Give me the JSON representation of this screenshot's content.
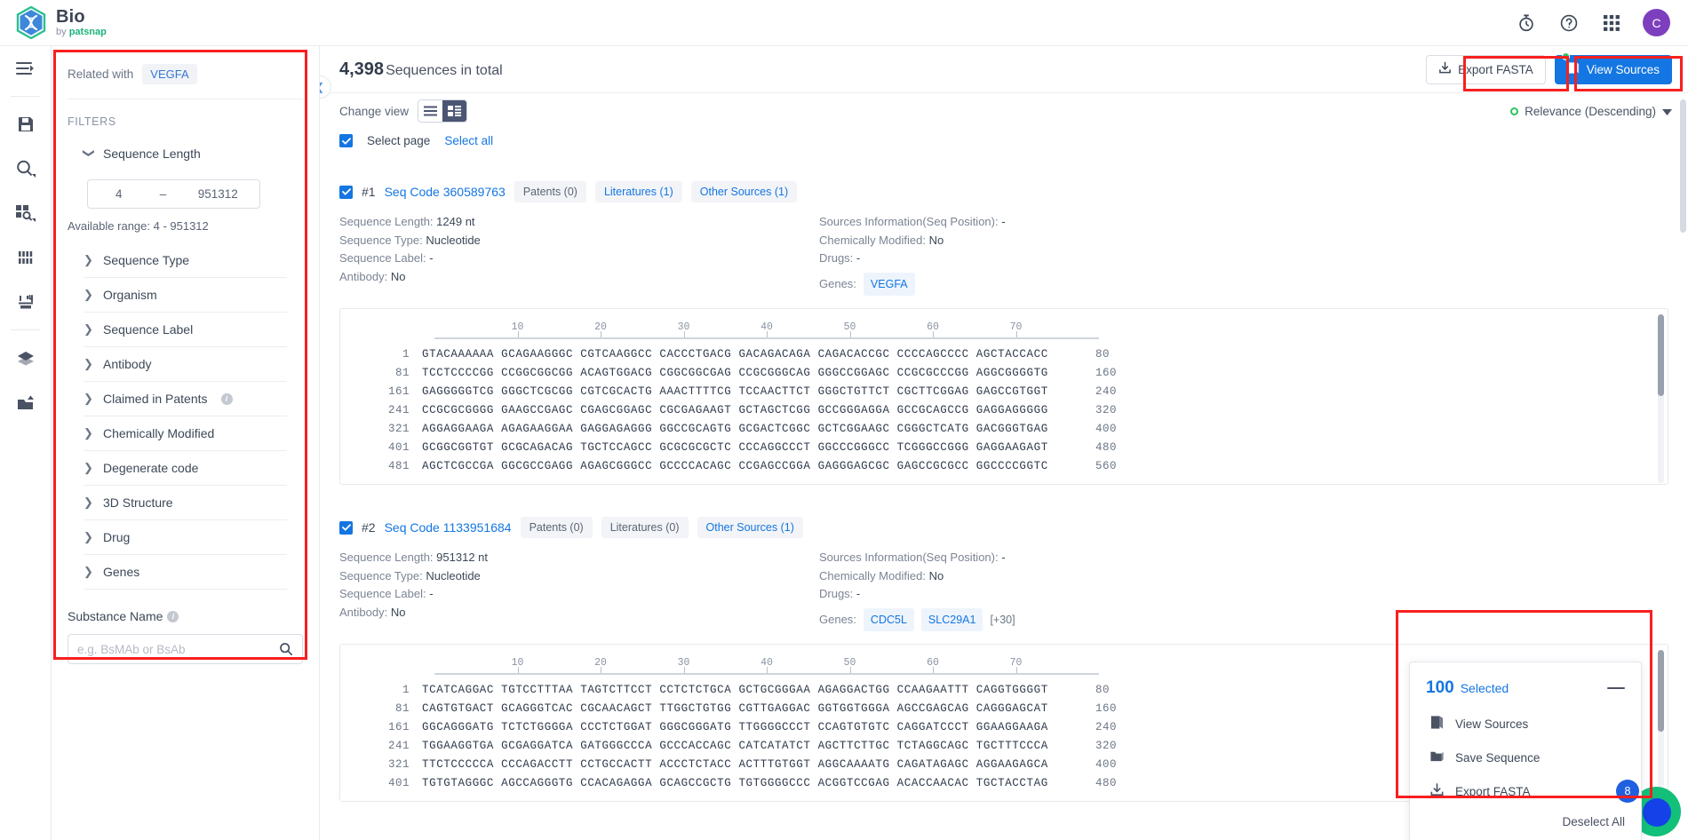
{
  "brand": {
    "title": "Bio",
    "by": "by ",
    "company": "patsnap",
    "logo_icon": "hexagon-dna-icon"
  },
  "topbar": {
    "icons": [
      {
        "name": "history-timer-icon",
        "glyph": "timer"
      },
      {
        "name": "help-question-icon",
        "glyph": "question"
      },
      {
        "name": "apps-grid-icon",
        "glyph": "grid"
      }
    ],
    "avatar_initial": "C",
    "avatar_color": "#7d3fbe"
  },
  "rail": {
    "items": [
      {
        "name": "collapse-menu-icon",
        "glyph": "menu-arrow"
      },
      {
        "name": "saved-documents-icon",
        "glyph": "floppy"
      },
      {
        "name": "search-icon",
        "glyph": "magnifier"
      },
      {
        "name": "structure-search-icon",
        "glyph": "blocks-search"
      },
      {
        "name": "sequence-icon",
        "glyph": "barcode"
      },
      {
        "name": "tools-icon",
        "glyph": "sliders"
      },
      {
        "name": "library-icon",
        "glyph": "box"
      },
      {
        "name": "export-inbox-icon",
        "glyph": "inbox-up"
      }
    ]
  },
  "filters": {
    "related_label": "Related with",
    "related_chip": "VEGFA",
    "heading": "FILTERS",
    "sequence_length": {
      "label": "Sequence Length",
      "min": "4",
      "max": "951312",
      "separator": "–",
      "available_range": "Available range: 4 - 951312"
    },
    "groups": [
      {
        "label": "Sequence Type",
        "info": false
      },
      {
        "label": "Organism",
        "info": false
      },
      {
        "label": "Sequence Label",
        "info": false
      },
      {
        "label": "Antibody",
        "info": false
      },
      {
        "label": "Claimed in Patents",
        "info": true
      },
      {
        "label": "Chemically Modified",
        "info": false
      },
      {
        "label": "Degenerate code",
        "info": false
      },
      {
        "label": "3D Structure",
        "info": false
      },
      {
        "label": "Drug",
        "info": false
      },
      {
        "label": "Genes",
        "info": false
      }
    ],
    "substance": {
      "label": "Substance Name",
      "placeholder": "e.g. BsMAb or BsAb",
      "value": ""
    },
    "highlight_color": "#f81f1f"
  },
  "main": {
    "total_count": "4,398",
    "total_suffix": "Sequences in total",
    "export_fasta": "Export FASTA",
    "view_sources": "View Sources",
    "change_view_label": "Change view",
    "sort_label": "Relevance (Descending)",
    "select_page": "Select page",
    "select_all": "Select all"
  },
  "records": [
    {
      "index": "#1",
      "code_label": "Seq Code 360589763",
      "tags": [
        {
          "text": "Patents (0)",
          "blue": false
        },
        {
          "text": "Literatures (1)",
          "blue": true
        },
        {
          "text": "Other Sources (1)",
          "blue": true
        }
      ],
      "left_fields": [
        {
          "label": "Sequence Length:",
          "value": "1249 nt"
        },
        {
          "label": "Sequence Type:",
          "value": "Nucleotide"
        },
        {
          "label": "Sequence Label:",
          "value": "-"
        },
        {
          "label": "Antibody:",
          "value": "No"
        }
      ],
      "right_fields": [
        {
          "label": "Sources Information(Seq Position):",
          "value": "-"
        },
        {
          "label": "Chemically Modified:",
          "value": "No"
        },
        {
          "label": "Drugs:",
          "value": "-"
        }
      ],
      "genes_label": "Genes:",
      "genes": [
        "VEGFA"
      ],
      "genes_more": "",
      "ruler_ticks": [
        10,
        20,
        30,
        40,
        50,
        60,
        70
      ],
      "rows": [
        {
          "start": "1",
          "bases": "GTACAAAAAA GCAGAAGGGC CGTCAAGGCC CACCCTGACG GACAGACAGA CAGACACCGC CCCCAGCCCC AGCTACCACC",
          "end": "80"
        },
        {
          "start": "81",
          "bases": "TCCTCCCCGG CCGGCGGCGG ACAGTGGACG CGGCGGCGAG CCGCGGGCAG GGGCCGGAGC CCGCGCCCGG AGGCGGGGTG",
          "end": "160"
        },
        {
          "start": "161",
          "bases": "GAGGGGGTCG GGGCTCGCGG CGTCGCACTG AAACTTTTCG TCCAACTTCT GGGCTGTTCT CGCTTCGGAG GAGCCGTGGT",
          "end": "240"
        },
        {
          "start": "241",
          "bases": "CCGCGCGGGG GAAGCCGAGC CGAGCGGAGC CGCGAGAAGT GCTAGCTCGG GCCGGGAGGA GCCGCAGCCG GAGGAGGGGG",
          "end": "320"
        },
        {
          "start": "321",
          "bases": "AGGAGGAAGA AGAGAAGGAA GAGGAGAGGG GGCCGCAGTG GCGACTCGGC GCTCGGAAGC CGGGCTCATG GACGGGTGAG",
          "end": "400"
        },
        {
          "start": "401",
          "bases": "GCGGCGGTGT GCGCAGACAG TGCTCCAGCC GCGCGCGCTC CCCAGGCCCT GGCCCGGGCC TCGGGCCGGG GAGGAAGAGT",
          "end": "480"
        },
        {
          "start": "481",
          "bases": "AGCTCGCCGA GGCGCCGAGG AGAGCGGGCC GCCCCACAGC CCGAGCCGGA GAGGGAGCGC GAGCCGCGCC GGCCCCGGTC",
          "end": "560"
        }
      ]
    },
    {
      "index": "#2",
      "code_label": "Seq Code 1133951684",
      "tags": [
        {
          "text": "Patents (0)",
          "blue": false
        },
        {
          "text": "Literatures (0)",
          "blue": false
        },
        {
          "text": "Other Sources (1)",
          "blue": true
        }
      ],
      "left_fields": [
        {
          "label": "Sequence Length:",
          "value": "951312 nt"
        },
        {
          "label": "Sequence Type:",
          "value": "Nucleotide"
        },
        {
          "label": "Sequence Label:",
          "value": "-"
        },
        {
          "label": "Antibody:",
          "value": "No"
        }
      ],
      "right_fields": [
        {
          "label": "Sources Information(Seq Position):",
          "value": "-"
        },
        {
          "label": "Chemically Modified:",
          "value": "No"
        },
        {
          "label": "Drugs:",
          "value": "-"
        }
      ],
      "genes_label": "Genes:",
      "genes": [
        "CDC5L",
        "SLC29A1"
      ],
      "genes_more": "[+30]",
      "ruler_ticks": [
        10,
        20,
        30,
        40,
        50,
        60,
        70
      ],
      "rows": [
        {
          "start": "1",
          "bases": "TCATCAGGAC TGTCCTTTAA TAGTCTTCCT CCTCTCTGCA GCTGCGGGAA AGAGGACTGG CCAAGAATTT CAGGTGGGGT",
          "end": "80"
        },
        {
          "start": "81",
          "bases": "CAGTGTGACT GCAGGGTCAC CGCAACAGCT TTGGCTGTGG CGTTGAGGAC GGTGGTGGGA AGCCGAGCAG CAGGGAGCAT",
          "end": "160"
        },
        {
          "start": "161",
          "bases": "GGCAGGGATG TCTCTGGGGA CCCTCTGGAT GGGCGGGATG TTGGGGCCCT CCAGTGTGTC CAGGATCCCT GGAAGGAAGA",
          "end": "240"
        },
        {
          "start": "241",
          "bases": "TGGAAGGTGA GCGAGGATCA GATGGGCCCA GCCCACCAGC CATCATATCT AGCTTCTTGC TCTAGGCAGC TGCTTTCCCA",
          "end": "320"
        },
        {
          "start": "321",
          "bases": "TTCTCCCCCA CCCAGACCTT CCTGCCACTT ACCCTCTACC ACTTTGTGGT AGGCAAAATG CAGATAGAGC AGGAAGAGCA",
          "end": "400"
        },
        {
          "start": "401",
          "bases": "TGTGTAGGGC AGCCAGGGTG CCACAGAGGA GCAGCCGCTG TGTGGGGCCC ACGGTCCGAG ACACCAACAC TGCTACCTAG",
          "end": "480"
        }
      ]
    }
  ],
  "selected_panel": {
    "count": "100",
    "word": "Selected",
    "actions": [
      {
        "label": "View Sources",
        "icon": "book-icon"
      },
      {
        "label": "Save Sequence",
        "icon": "folder-icon"
      },
      {
        "label": "Export FASTA",
        "icon": "download-icon"
      }
    ],
    "deselect_all": "Deselect All"
  },
  "chat": {
    "badge": "8"
  },
  "colors": {
    "accent": "#1476e2",
    "highlight": "#f81f1f",
    "green": "#2ec45f",
    "avatar": "#7d3fbe"
  }
}
